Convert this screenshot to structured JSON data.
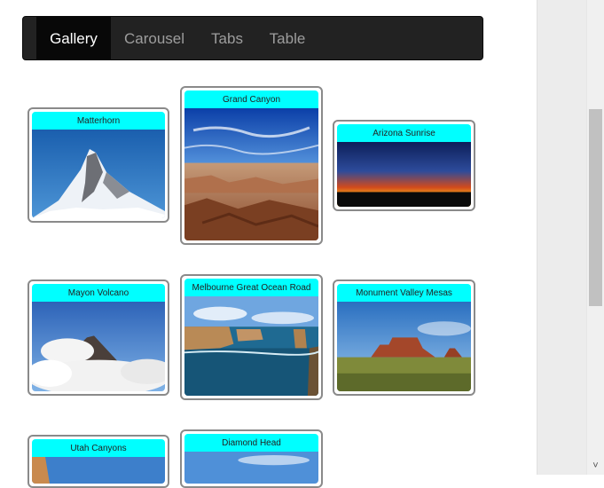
{
  "nav": {
    "items": [
      {
        "label": "Gallery",
        "active": true
      },
      {
        "label": "Carousel",
        "active": false
      },
      {
        "label": "Tabs",
        "active": false
      },
      {
        "label": "Table",
        "active": false
      }
    ]
  },
  "gallery": {
    "caption_color": "#00ffff",
    "items": [
      {
        "title": "Matterhorn",
        "image": "mountain-photo"
      },
      {
        "title": "Grand Canyon",
        "image": "canyon-photo"
      },
      {
        "title": "Arizona Sunrise",
        "image": "sunrise-photo"
      },
      {
        "title": "Mayon Volcano",
        "image": "volcano-photo"
      },
      {
        "title": "Melbourne Great Ocean Road",
        "image": "coast-photo"
      },
      {
        "title": "Monument Valley Mesas",
        "image": "mesa-photo"
      },
      {
        "title": "Utah Canyons",
        "image": "utah-photo"
      },
      {
        "title": "Diamond Head",
        "image": "diamond-head-photo"
      }
    ]
  },
  "scrollbar": {
    "down_arrow": "˅"
  }
}
